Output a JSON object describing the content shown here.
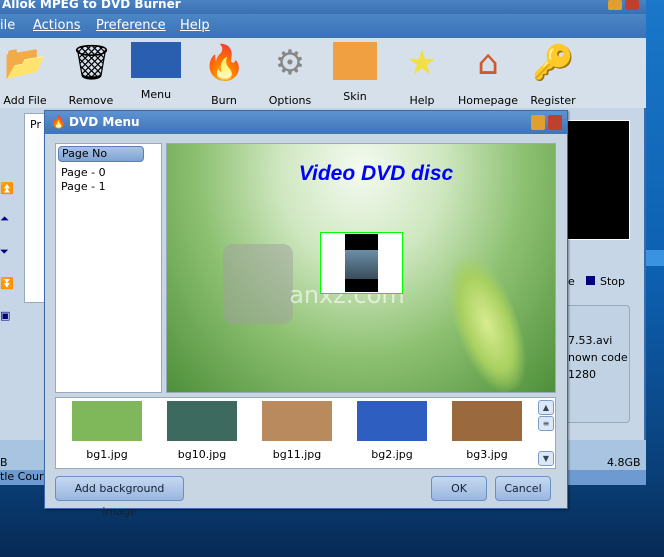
{
  "main_window": {
    "title": "Allok MPEG to DVD Burner",
    "menu": [
      "ile",
      "Actions",
      "Preference",
      "Help"
    ],
    "toolbar": [
      {
        "label": "Add File",
        "icon": "folder-icon"
      },
      {
        "label": "Remove",
        "icon": "trash-icon"
      },
      {
        "label": "Menu",
        "icon": "menu-icon"
      },
      {
        "label": "Burn",
        "icon": "burn-icon"
      },
      {
        "label": "Options",
        "icon": "gear-icon"
      },
      {
        "label": "Skin",
        "icon": "skin-icon"
      },
      {
        "label": "Help",
        "icon": "star-icon"
      },
      {
        "label": "Homepage",
        "icon": "home-icon"
      },
      {
        "label": "Register",
        "icon": "key-icon"
      }
    ],
    "left_tab": "Pr",
    "stop_label": "Stop",
    "play_label_partial": "e",
    "info": [
      "7.53.avi",
      "nown codec",
      "1280"
    ],
    "ruler_left": "B",
    "ruler_right": "4.8GB",
    "status_partial": "tle Cour"
  },
  "dialog": {
    "title": "DVD Menu",
    "page_list": {
      "header": "Page No",
      "items": [
        "Page - 0",
        "Page - 1"
      ]
    },
    "preview_title": "Video DVD disc",
    "watermark": "anxz.com",
    "backgrounds": [
      {
        "name": "bg1.jpg",
        "color": "#7fb85a"
      },
      {
        "name": "bg10.jpg",
        "color": "#3c6a5e"
      },
      {
        "name": "bg11.jpg",
        "color": "#b88a5e"
      },
      {
        "name": "bg2.jpg",
        "color": "#2e5fc0"
      },
      {
        "name": "bg3.jpg",
        "color": "#9a6a3e"
      }
    ],
    "add_bg_button": "Add background image",
    "ok_button": "OK",
    "cancel_button": "Cancel"
  }
}
